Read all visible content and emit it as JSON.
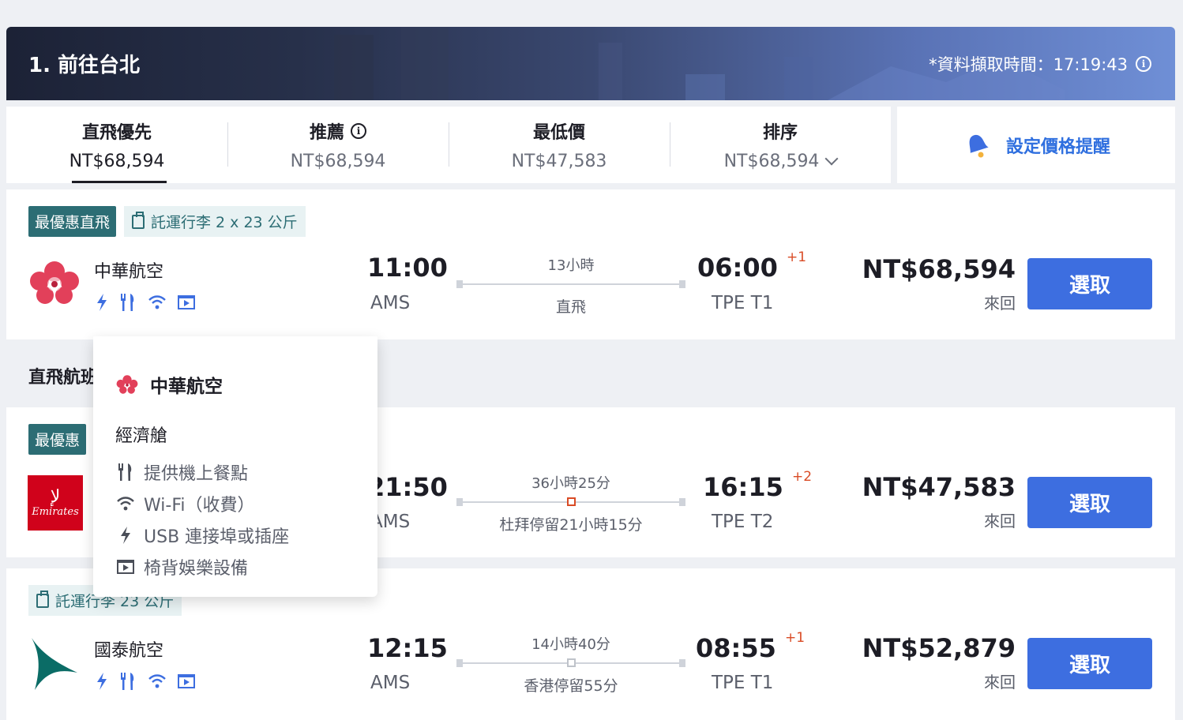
{
  "header": {
    "title": "1. 前往台北",
    "timestamp": "*資料擷取時間：17:19:43",
    "info_icon": "info-icon"
  },
  "sort_tabs": [
    {
      "label": "直飛優先",
      "price": "NT$68,594",
      "active": true
    },
    {
      "label": "推薦",
      "price": "NT$68,594",
      "active": false,
      "icon": "info-icon"
    },
    {
      "label": "最低價",
      "price": "NT$47,583",
      "active": false
    },
    {
      "label": "排序",
      "price": "NT$68,594",
      "active": false,
      "icon": "chevron-down-icon"
    }
  ],
  "price_alert": {
    "label": "設定價格提醒",
    "icon": "bell-icon"
  },
  "section_title": "直飛航班",
  "flights": [
    {
      "tag": "最優惠直飛",
      "baggage": "託運行李 2 x 23 公斤",
      "airline": "中華航空",
      "dep_time": "11:00",
      "dep_code": "AMS",
      "duration": "13小時",
      "route_note": "直飛",
      "arr_time": "06:00",
      "arr_plus": "+1",
      "arr_code": "TPE T1",
      "price": "NT$68,594",
      "price_sub": "來回",
      "button": "選取"
    },
    {
      "tag": "最優惠",
      "airline": "Emirates",
      "dep_time": "21:50",
      "dep_code": "AMS",
      "duration": "36小時25分",
      "route_note": "杜拜停留21小時15分",
      "arr_time": "16:15",
      "arr_plus": "+2",
      "arr_code": "TPE T2",
      "price": "NT$47,583",
      "price_sub": "來回",
      "button": "選取"
    },
    {
      "baggage": "託運行李 23 公斤",
      "airline": "國泰航空",
      "dep_time": "12:15",
      "dep_code": "AMS",
      "duration": "14小時40分",
      "route_note": "香港停留55分",
      "arr_time": "08:55",
      "arr_plus": "+1",
      "arr_code": "TPE T1",
      "price": "NT$52,879",
      "price_sub": "來回",
      "button": "選取"
    }
  ],
  "popover": {
    "airline": "中華航空",
    "cabin": "經濟艙",
    "amenities": [
      {
        "icon": "meal-icon",
        "label": "提供機上餐點"
      },
      {
        "icon": "wifi-icon",
        "label": "Wi-Fi（收費）"
      },
      {
        "icon": "power-icon",
        "label": "USB 連接埠或插座"
      },
      {
        "icon": "entertainment-icon",
        "label": "椅背娛樂設備"
      }
    ]
  },
  "colors": {
    "accent_blue": "#3d6ee0",
    "deal_teal": "#2c6d74",
    "stop_orange": "#d94b25"
  }
}
